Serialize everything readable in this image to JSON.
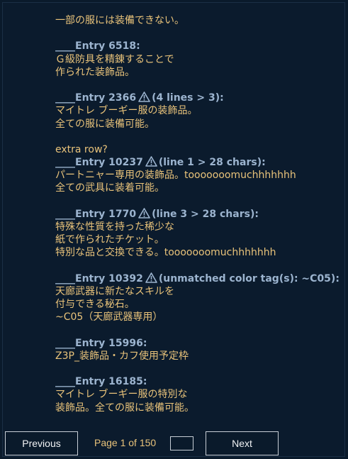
{
  "content": {
    "intro_line": "一部の服には装備できない。",
    "entries": [
      {
        "header": "____Entry 6518:",
        "warning": "",
        "lines": [
          "Ｇ級防具を精錬することで",
          "作られた装飾品。"
        ],
        "extra": ""
      },
      {
        "header": "____Entry 2366",
        "warning": "(4 lines > 3):",
        "lines": [
          "マイトレ ブーギー服の装飾品。",
          "全ての服に装備可能。"
        ],
        "extra": "extra row?"
      },
      {
        "header": "____Entry 10237",
        "warning": "(line 1 > 28 chars):",
        "lines": [
          "パートニャー専用の装飾品。tooooooomuchhhhhhh",
          "全ての武具に装着可能。"
        ],
        "extra": ""
      },
      {
        "header": "____Entry 1770",
        "warning": "(line 3 > 28 chars):",
        "lines": [
          "特殊な性質を持った稀少な",
          "紙で作られたチケット。",
          "特別な品と交換できる。tooooooomuchhhhhhh"
        ],
        "extra": ""
      },
      {
        "header": "____Entry 10392",
        "warning": "(unmatched color tag(s): ~C05):",
        "lines": [
          "天廊武器に新たなスキルを",
          "付与できる秘石。",
          "~C05（天廊武器専用）"
        ],
        "extra": ""
      },
      {
        "header": "____Entry 15996:",
        "warning": "",
        "lines": [
          "Z3P_装飾品・カフ使用予定枠"
        ],
        "extra": ""
      },
      {
        "header": "____Entry 16185:",
        "warning": "",
        "lines": [
          "マイトレ ブーギー服の特別な",
          "装飾品。全ての服に装備可能。"
        ],
        "extra": ""
      }
    ]
  },
  "footer": {
    "prev_label": "Previous",
    "page_label": "Page 1 of 150",
    "page_input_value": "",
    "next_label": "Next"
  },
  "colors": {
    "background": "#0b1b2d",
    "entry_text": "#e9c37a",
    "header_text": "#9cb4cf",
    "button_border": "#c7ced6"
  },
  "icons": {
    "warning": "warning-triangle-icon"
  }
}
